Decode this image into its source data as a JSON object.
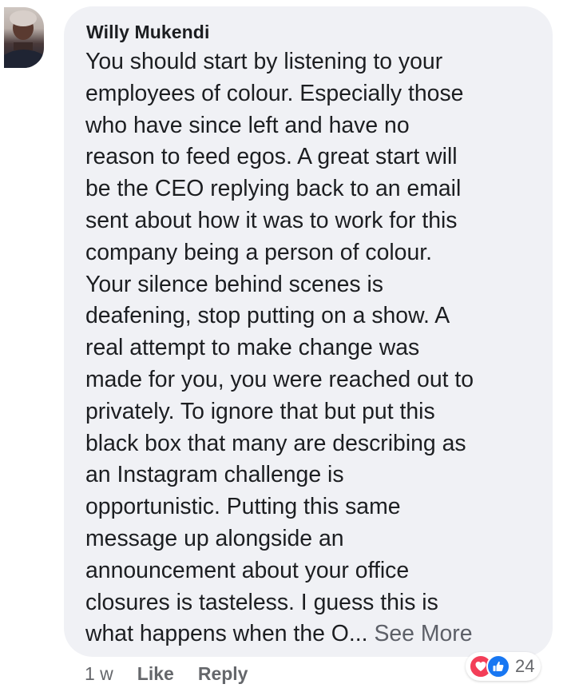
{
  "comment": {
    "author": "Willy Mukendi",
    "body_lines": [
      "You should start by listening to your",
      "employees of colour. Especially those",
      "who have since left and have no",
      "reason to feed egos. A great start will",
      "be the CEO replying back to an email",
      "sent about how it was to work for this",
      "company being a person of colour.",
      "Your silence behind scenes is",
      "deafening, stop putting on a show. A",
      "real attempt to make change was",
      "made for you, you were reached out to",
      "privately. To ignore that but put this",
      "black box that many are describing as",
      "an Instagram challenge is",
      "opportunistic. Putting this same",
      "message up alongside an",
      "announcement about your office",
      "closures is tasteless. I guess this is"
    ],
    "last_line": "what happens when the O...",
    "see_more_label": "See More",
    "timestamp": "1 w",
    "like_label": "Like",
    "reply_label": "Reply",
    "reaction_count": "24",
    "reaction_icons": [
      "heart-icon",
      "like-icon"
    ]
  },
  "colors": {
    "bubble": "#f0f1f5",
    "text": "#1c1e21",
    "meta": "#65676b",
    "love": "#f33e58",
    "like": "#1877f2"
  }
}
